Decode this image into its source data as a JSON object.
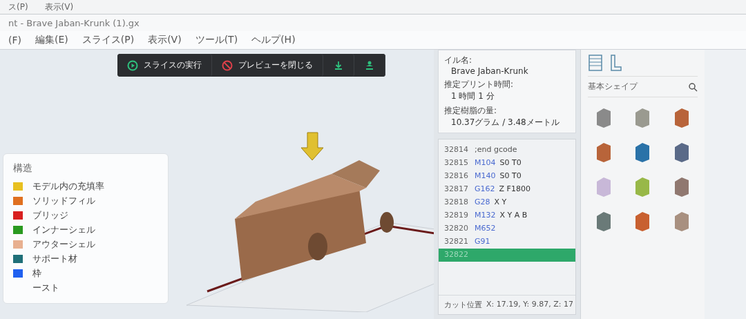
{
  "background_window": {
    "menu": [
      "ス(P)",
      "表示(V)"
    ]
  },
  "window": {
    "title": "nt - Brave Jaban-Krunk (1).gx"
  },
  "menu_bar": [
    "(F)",
    "編集(E)",
    "スライス(P)",
    "表示(V)",
    "ツール(T)",
    "ヘルプ(H)"
  ],
  "toolbar": [
    {
      "kind": "play",
      "label": "スライスの実行"
    },
    {
      "kind": "stop",
      "label": "プレビューを閉じる"
    },
    {
      "kind": "download"
    },
    {
      "kind": "figure"
    }
  ],
  "legend": {
    "title": "構造",
    "items": [
      {
        "label": "モデル内の充填率",
        "color": "#e8c020"
      },
      {
        "label": "ソリッドフィル",
        "color": "#e07020"
      },
      {
        "label": "ブリッジ",
        "color": "#d82020"
      },
      {
        "label": "インナーシェル",
        "color": "#2a9a20"
      },
      {
        "label": "アウターシェル",
        "color": "#e8b090"
      },
      {
        "label": "サポート材",
        "color": "#1f6f78"
      },
      {
        "label": "枠",
        "color": "#2060f0"
      },
      {
        "label": "ースト"
      }
    ]
  },
  "print_info": [
    {
      "label": "イル名:",
      "value": "Brave Jaban-Krunk"
    },
    {
      "label": "推定プリント時間:",
      "value": "1 時間 1 分"
    },
    {
      "label": "推定樹脂の量:",
      "value": "10.37グラム / 3.48メートル"
    }
  ],
  "gcode": {
    "lines": [
      {
        "number": "32814",
        "command": ";end gcode",
        "selected": false
      },
      {
        "number": "32815",
        "command": "M104",
        "args": "S0 T0",
        "selected": false
      },
      {
        "number": "32816",
        "command": "M140",
        "args": "S0 T0",
        "selected": false
      },
      {
        "number": "32817",
        "command": "G162",
        "args": "Z F1800",
        "selected": false
      },
      {
        "number": "32818",
        "command": "G28",
        "args": "X Y",
        "selected": false
      },
      {
        "number": "32819",
        "command": "M132",
        "args": "X Y A B",
        "selected": false
      },
      {
        "number": "32820",
        "command": "M652",
        "selected": false
      },
      {
        "number": "32821",
        "command": "G91",
        "selected": false
      },
      {
        "number": "32822",
        "selected": true
      }
    ],
    "cut_label": "カット位置",
    "cut_value": "X: 17.19, Y: 9.87, Z: 17"
  },
  "shapes": {
    "title": "基本シェイプ",
    "items": [
      {
        "color": "#8a8a8a"
      },
      {
        "color": "#9a9a90"
      },
      {
        "color": "#b8643a"
      },
      {
        "color": "#b8643a"
      },
      {
        "color": "#2a72a8"
      },
      {
        "color": "#5a6a88"
      },
      {
        "color": "#c8b8d8"
      },
      {
        "color": "#98b848"
      },
      {
        "color": "#907870"
      },
      {
        "color": "#6a7a78"
      },
      {
        "color": "#c86030"
      },
      {
        "color": "#a89080"
      }
    ]
  }
}
